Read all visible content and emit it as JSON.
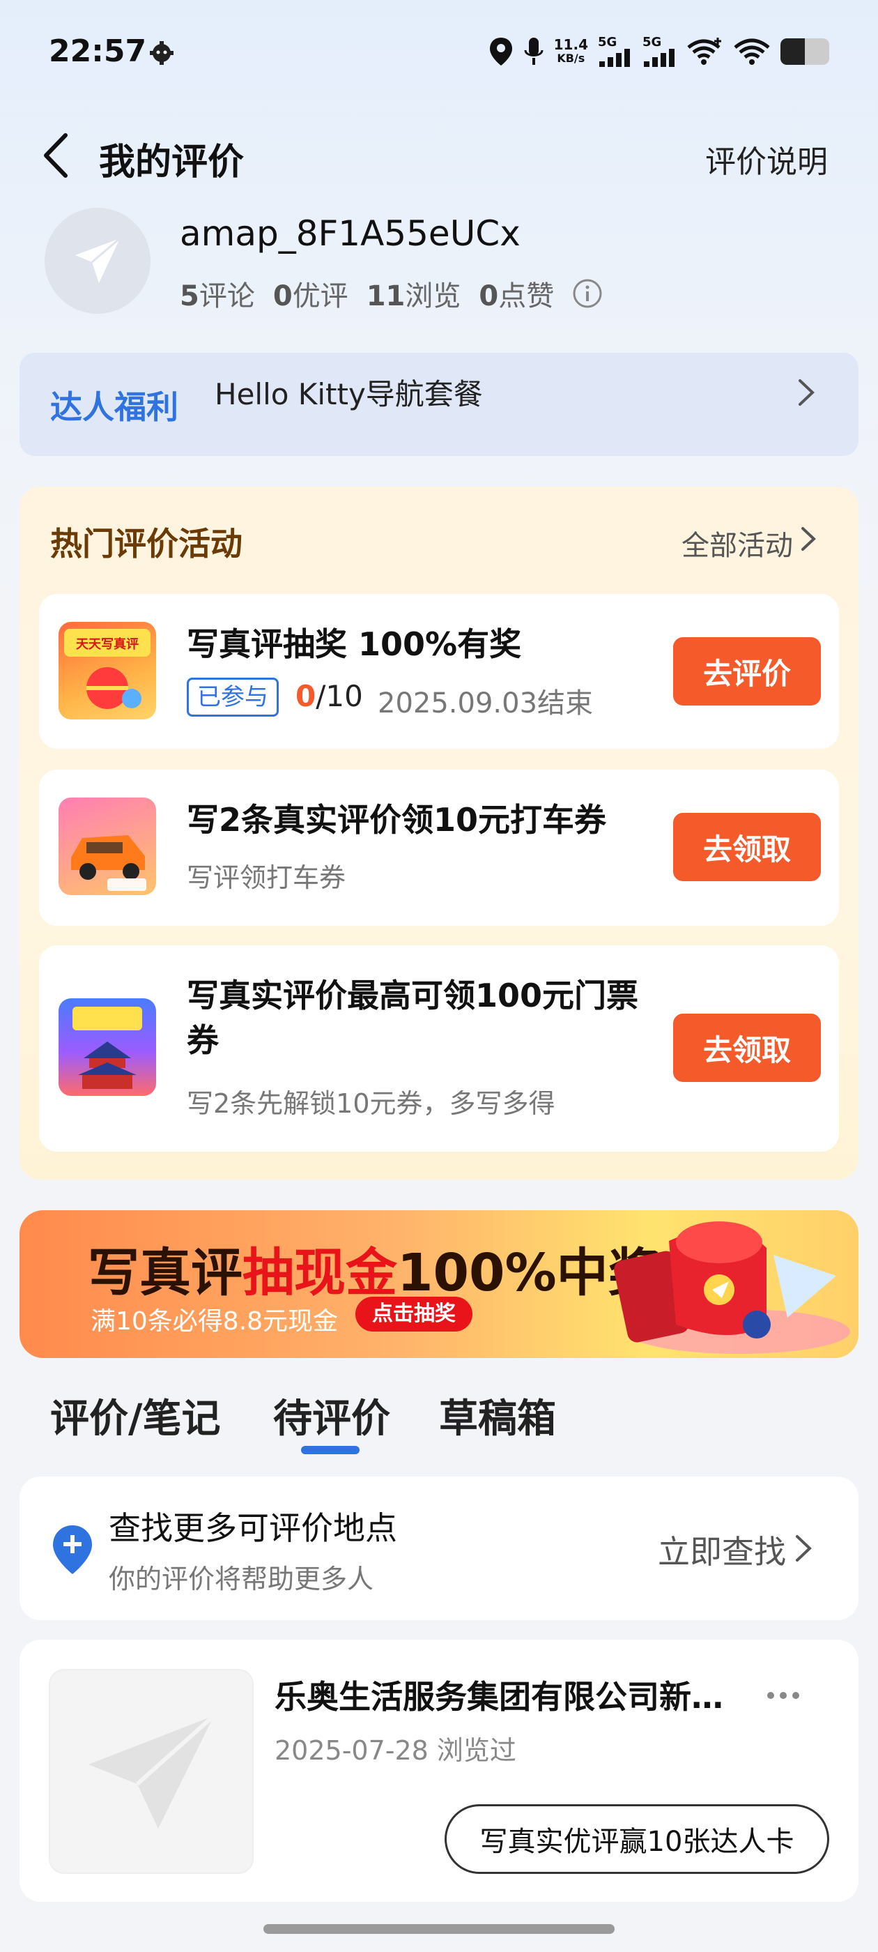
{
  "status_bar": {
    "time": "22:57",
    "net_speed_value": "11.4",
    "net_speed_unit": "KB/s",
    "sim1": "5G",
    "sim2": "5G",
    "battery_level": 0.5
  },
  "header": {
    "title": "我的评价",
    "help_label": "评价说明"
  },
  "profile": {
    "username": "amap_8F1A55eUCx",
    "stats": [
      {
        "value": "5",
        "label": "评论"
      },
      {
        "value": "0",
        "label": "优评"
      },
      {
        "value": "11",
        "label": "浏览"
      },
      {
        "value": "0",
        "label": "点赞"
      }
    ]
  },
  "perks": {
    "label": "达人福利",
    "text": "Hello Kitty导航套餐"
  },
  "activities": {
    "title": "热门评价活动",
    "all_label": "全部活动",
    "items": [
      {
        "name": "写真评抽奖 100%有奖",
        "badge": "已参与",
        "progress_done": "0",
        "progress_total": "/10",
        "end_date": "2025.09.03结束",
        "button": "去评价",
        "thumb_text": "天天写真评"
      },
      {
        "name": "写2条真实评价领10元打车券",
        "sub": "写评领打车券",
        "button": "去领取"
      },
      {
        "name_line1": "写真实评价最高可领100元门票",
        "name_line2": "券",
        "sub": "写2条先解锁10元券，多写多得",
        "button": "去领取"
      }
    ]
  },
  "banner": {
    "part1": "写真评",
    "part2": "抽现金",
    "part3": "100%中奖",
    "sub": "满10条必得8.8元现金",
    "cta": "点击抽奖"
  },
  "tabs": [
    {
      "label": "评价/笔记"
    },
    {
      "label": "待评价"
    },
    {
      "label": "草稿箱"
    }
  ],
  "find_more": {
    "title": "查找更多可评价地点",
    "sub": "你的评价将帮助更多人",
    "action": "立即查找"
  },
  "pending": {
    "name": "乐奥生活服务集团有限公司新…",
    "date": "2025-07-28 浏览过",
    "button": "写真实优评赢10张达人卡"
  },
  "colors": {
    "accent_blue": "#2f73e0",
    "accent_orange": "#f55a2a",
    "activity_title": "#6b3a05"
  }
}
